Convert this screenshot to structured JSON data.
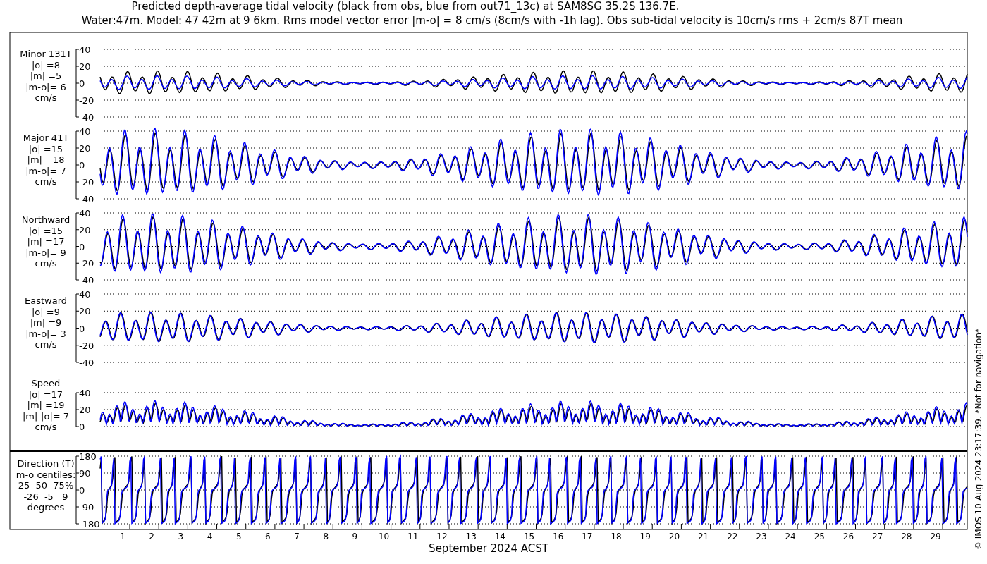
{
  "title_lines": [
    "Predicted depth-average tidal velocity (black from obs, blue from out71_13c) at SAM8SG 35.2S 136.7E.",
    "Water:47m. Model: 47 42m at 9 6km. Rms model vector error |m-o| = 8 cm/s (8cm/s with -1h lag). Obs sub-tidal velocity is 10cm/s rms + 2cm/s 87T mean"
  ],
  "panels": [
    {
      "kind": "velocity",
      "label": [
        "Minor 131T",
        "|o| =8",
        "|m| =5",
        "|m-o|= 6",
        "cm/s"
      ],
      "yticks": [
        "40",
        "20",
        "0",
        "-20",
        "-40"
      ]
    },
    {
      "kind": "velocity",
      "label": [
        "Major 41T",
        "|o| =15",
        "|m| =18",
        "|m-o|= 7",
        "cm/s"
      ],
      "yticks": [
        "40",
        "20",
        "0",
        "-20",
        "-40"
      ]
    },
    {
      "kind": "velocity",
      "label": [
        "Northward",
        "|o| =15",
        "|m| =17",
        "|m-o|= 9",
        "cm/s"
      ],
      "yticks": [
        "40",
        "20",
        "0",
        "-20",
        "-40"
      ]
    },
    {
      "kind": "velocity",
      "label": [
        "Eastward",
        "|o| =9",
        "|m| =9",
        "|m-o|= 3",
        "cm/s"
      ],
      "yticks": [
        "40",
        "20",
        "0",
        "-20",
        "-40"
      ]
    },
    {
      "kind": "speed",
      "label": [
        "Speed",
        "|o| =17",
        "|m| =19",
        "|m|-|o|= 7",
        "cm/s"
      ],
      "yticks": [
        "40",
        "20",
        "0"
      ]
    },
    {
      "kind": "direction",
      "label": [
        "Direction (T)",
        "m-o centiles:",
        "25  50  75%",
        "-26  -5   9",
        "degrees"
      ],
      "yticks": [
        "180",
        "90",
        "0",
        "-90",
        "-180"
      ]
    }
  ],
  "x_ticks": [
    "1",
    "2",
    "3",
    "4",
    "5",
    "6",
    "7",
    "8",
    "9",
    "10",
    "11",
    "12",
    "13",
    "14",
    "15",
    "16",
    "17",
    "18",
    "19",
    "20",
    "21",
    "22",
    "23",
    "24",
    "25",
    "26",
    "27",
    "28",
    "29"
  ],
  "x_label": "September 2024 ACST",
  "side_note": "© IMOS 10-Aug-2024 23:17:39. *Not for navigation*"
}
